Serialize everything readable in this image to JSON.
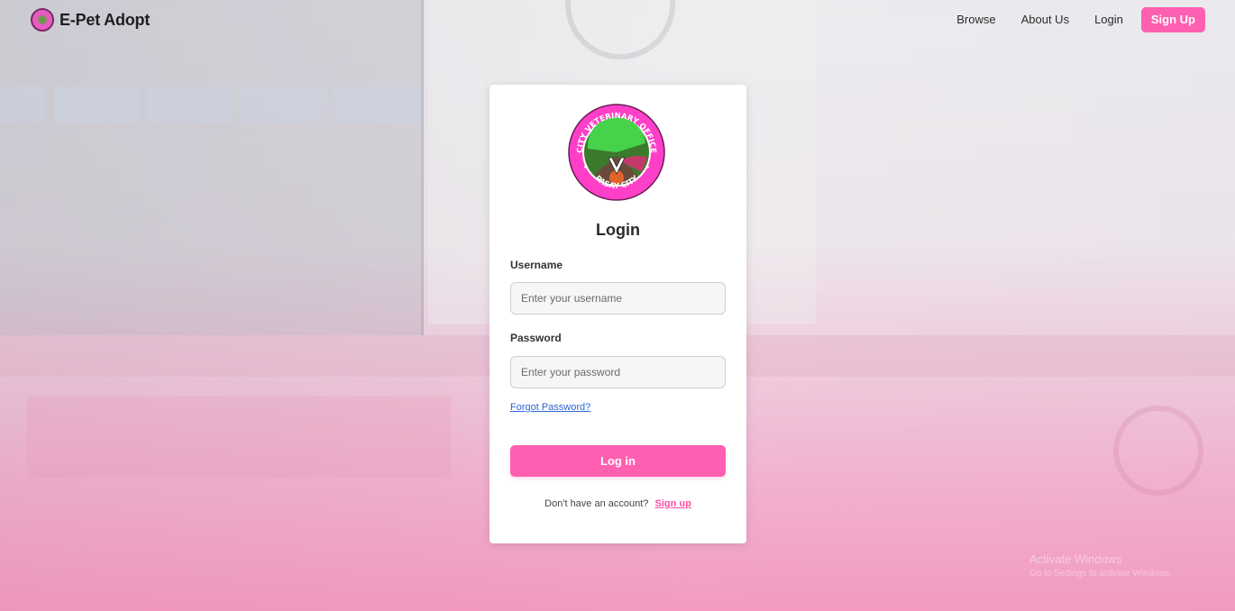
{
  "brand": {
    "name": "E-Pet Adopt"
  },
  "nav": {
    "browse": "Browse",
    "about": "About Us",
    "login": "Login",
    "signup": "Sign Up"
  },
  "login": {
    "title": "Login",
    "username_label": "Username",
    "username_placeholder": "Enter your username",
    "password_label": "Password",
    "password_placeholder": "Enter your password",
    "forgot": "Forgot Password?",
    "submit": "Log in",
    "no_account": "Don't have an account?",
    "signup_link": "Sign up"
  },
  "seal": {
    "top_text": "CITY VETERINARY OFFICE",
    "bottom_text": "PASAY CITY"
  },
  "watermark": {
    "title": "Activate Windows",
    "subtitle": "Go to Settings to activate Windows."
  },
  "colors": {
    "accent": "#ff5fb0",
    "link": "#2a66d9"
  },
  "icons": {
    "brand": "pet-logo-icon",
    "seal": "city-veterinary-seal-icon"
  }
}
